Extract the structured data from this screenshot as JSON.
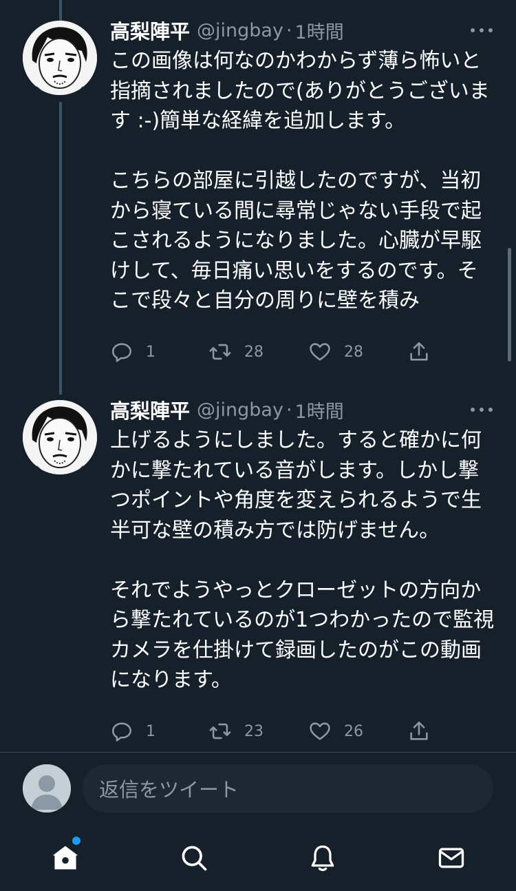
{
  "tweets": [
    {
      "name": "高梨陣平",
      "handle": "@jingbay",
      "separator": "·",
      "time": "1時間",
      "text": "この画像は何なのかわからず薄ら怖いと指摘されましたので(ありがとうございます :-)簡単な経緯を追加します。\n\nこちらの部屋に引越したのですが、当初から寝ている間に尋常じゃない手段で起こされるようになりました。心臓が早駆けして、毎日痛い思いをするのです。そこで段々と自分の周りに壁を積み",
      "replies": "1",
      "retweets": "28",
      "likes": "28"
    },
    {
      "name": "高梨陣平",
      "handle": "@jingbay",
      "separator": "·",
      "time": "1時間",
      "text": "上げるようにしました。すると確かに何かに撃たれている音がします。しかし撃つポイントや角度を変えられるようで生半可な壁の積み方では防げません。\n\nそれでようやっとクローゼットの方向から撃たれているのが1つわかったので監視カメラを仕掛けて録画したのがこの動画になります。",
      "replies": "1",
      "retweets": "23",
      "likes": "26"
    }
  ],
  "reply": {
    "placeholder": "返信をツイート"
  },
  "icons": {
    "reply": "reply-icon",
    "retweet": "retweet-icon",
    "like": "heart-icon",
    "share": "share-icon",
    "more": "more-icon",
    "nav": [
      "home-icon",
      "search-icon",
      "bell-icon",
      "mail-icon"
    ]
  },
  "colors": {
    "background": "#15202b",
    "secondary_text": "#8b98a5",
    "accent": "#1d9bf0",
    "thread_line": "#3d5466"
  }
}
